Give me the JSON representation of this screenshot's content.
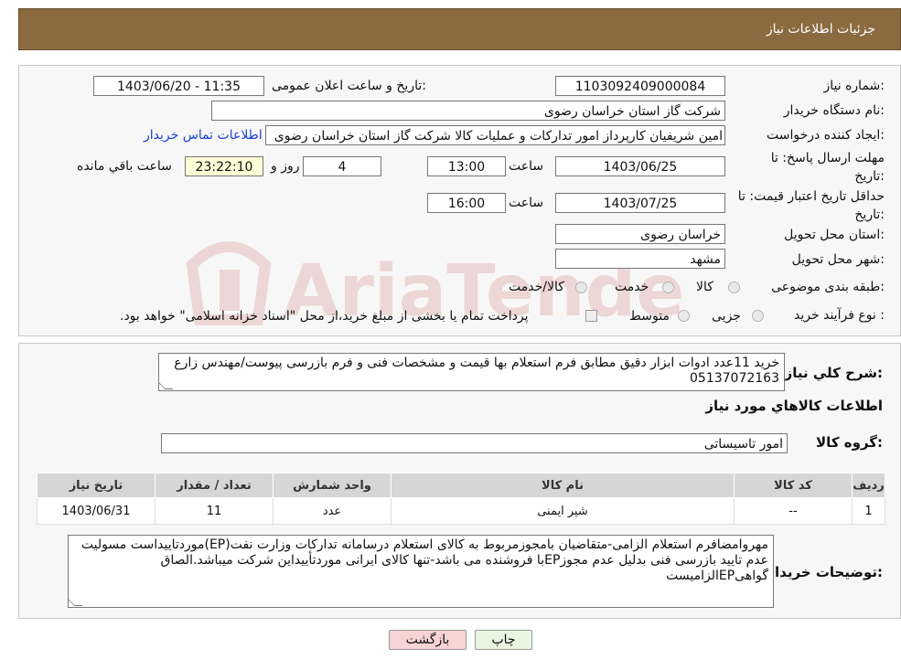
{
  "header": {
    "title": "جزئیات اطلاعات نیاز"
  },
  "labels": {
    "need_number": "شماره نیاز:",
    "announce_datetime": "تاریخ و ساعت اعلان عمومی:",
    "buyer_org": "نام دستگاه خریدار:",
    "requester": "ایجاد کننده درخواست:",
    "reply_deadline": "مهلت ارسال پاسخ: تا تاریخ:",
    "price_validity": "حداقل تاریخ اعتبار قیمت: تا تاریخ:",
    "time": "ساعت",
    "days_and": "روز و",
    "remaining": "ساعت باقي مانده",
    "delivery_province": "استان محل تحویل:",
    "delivery_city": "شهر محل تحویل:",
    "category": "طبقه بندی موضوعی:",
    "purchase_type": "نوع فرآیند خرید :",
    "general_desc": "شرح كلي نياز:",
    "goods_info": "اطلاعات کالاهاي مورد نياز",
    "goods_group": "گروه کالا:",
    "buyer_notes": "توضیحات خریدار:"
  },
  "values": {
    "need_number": "1103092409000084",
    "announce_datetime": "1403/06/20 - 11:35",
    "buyer_org": "شرکت گاز استان خراسان رضوی",
    "requester": "امین شریفیان کارپرداز امور تدارکات و عملیات کالا شرکت گاز استان خراسان رضوی",
    "contact_link": "اطلاعات تماس خریدار",
    "reply_date": "1403/06/25",
    "reply_time": "13:00",
    "reply_days": "4",
    "reply_remaining": "23:22:10",
    "validity_date": "1403/07/25",
    "validity_time": "16:00",
    "delivery_province": "خراسان رضوی",
    "delivery_city": "مشهد",
    "general_desc": "خرید 11عدد ادوات ابزار دقیق مطابق فرم استعلام بها قیمت و مشخصات فنی و فرم بازرسی پیوست/مهندس زارع 05137072163",
    "goods_group": "امور تاسیساتی",
    "buyer_notes": "مهروامضافرم استعلام الزامی-متقاضیان بامجوزمربوط به کالای استعلام درسامانه تدارکات وزارت نفت(EP)موردتاییداست مسولیت عدم تایید بازرسی فنی بدلیل عدم مجوزEPبا فروشنده می باشد-تنها کالای ایرانی موردتأییداین شرکت میباشد.الصاق گواهیEPالزامیست"
  },
  "category_options": [
    "کالا",
    "خدمت",
    "کالا/خدمت"
  ],
  "purchase_options": [
    "جزیی",
    "متوسط"
  ],
  "purchase_note": "پرداخت تمام یا بخشی از مبلغ خرید،از محل \"اسناد خزانه اسلامی\" خواهد بود.",
  "table": {
    "headers": [
      "ردیف",
      "کد کالا",
      "نام کالا",
      "واحد شمارش",
      "تعداد / مقدار",
      "تاریخ نیاز"
    ],
    "rows": [
      [
        "1",
        "--",
        "شیر ایمنی",
        "عدد",
        "11",
        "1403/06/31"
      ]
    ]
  },
  "buttons": {
    "print": "چاپ",
    "back": "بازگشت"
  },
  "watermark": {
    "text": "AriaTender.neT"
  },
  "colors": {
    "header_bg": "#8b6a3f",
    "link": "#1a3fd6",
    "back_button_bg": "#f8d4d4",
    "print_button_bg": "#e8f5e0"
  }
}
